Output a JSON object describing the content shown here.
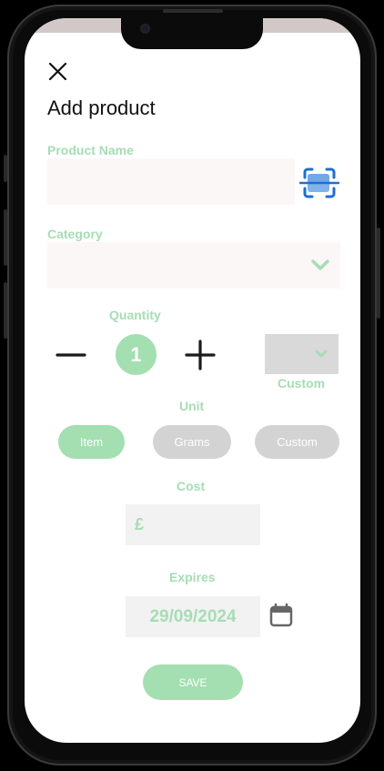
{
  "header": {
    "close_icon": "close-icon",
    "title": "Add product"
  },
  "product_name": {
    "label": "Product Name",
    "value": "",
    "scan_icon": "barcode-scan-icon"
  },
  "category": {
    "label": "Category",
    "selected": "",
    "dropdown_icon": "chevron-down-icon"
  },
  "quantity": {
    "label": "Quantity",
    "value": "1",
    "decrement_icon": "minus-icon",
    "increment_icon": "plus-icon",
    "custom_label": "Custom",
    "custom_selected": ""
  },
  "unit": {
    "label": "Unit",
    "options": [
      "Item",
      "Grams",
      "Custom"
    ],
    "selected": "Item"
  },
  "cost": {
    "label": "Cost",
    "currency_symbol": "£",
    "value": ""
  },
  "expires": {
    "label": "Expires",
    "value": "29/09/2024",
    "calendar_icon": "calendar-icon"
  },
  "actions": {
    "save_label": "SAVE"
  },
  "colors": {
    "accent": "#a3dfb1",
    "label": "#a6ddb4",
    "inactive_pill": "#d3d3d3",
    "input_bg": "#f2f2f2"
  }
}
